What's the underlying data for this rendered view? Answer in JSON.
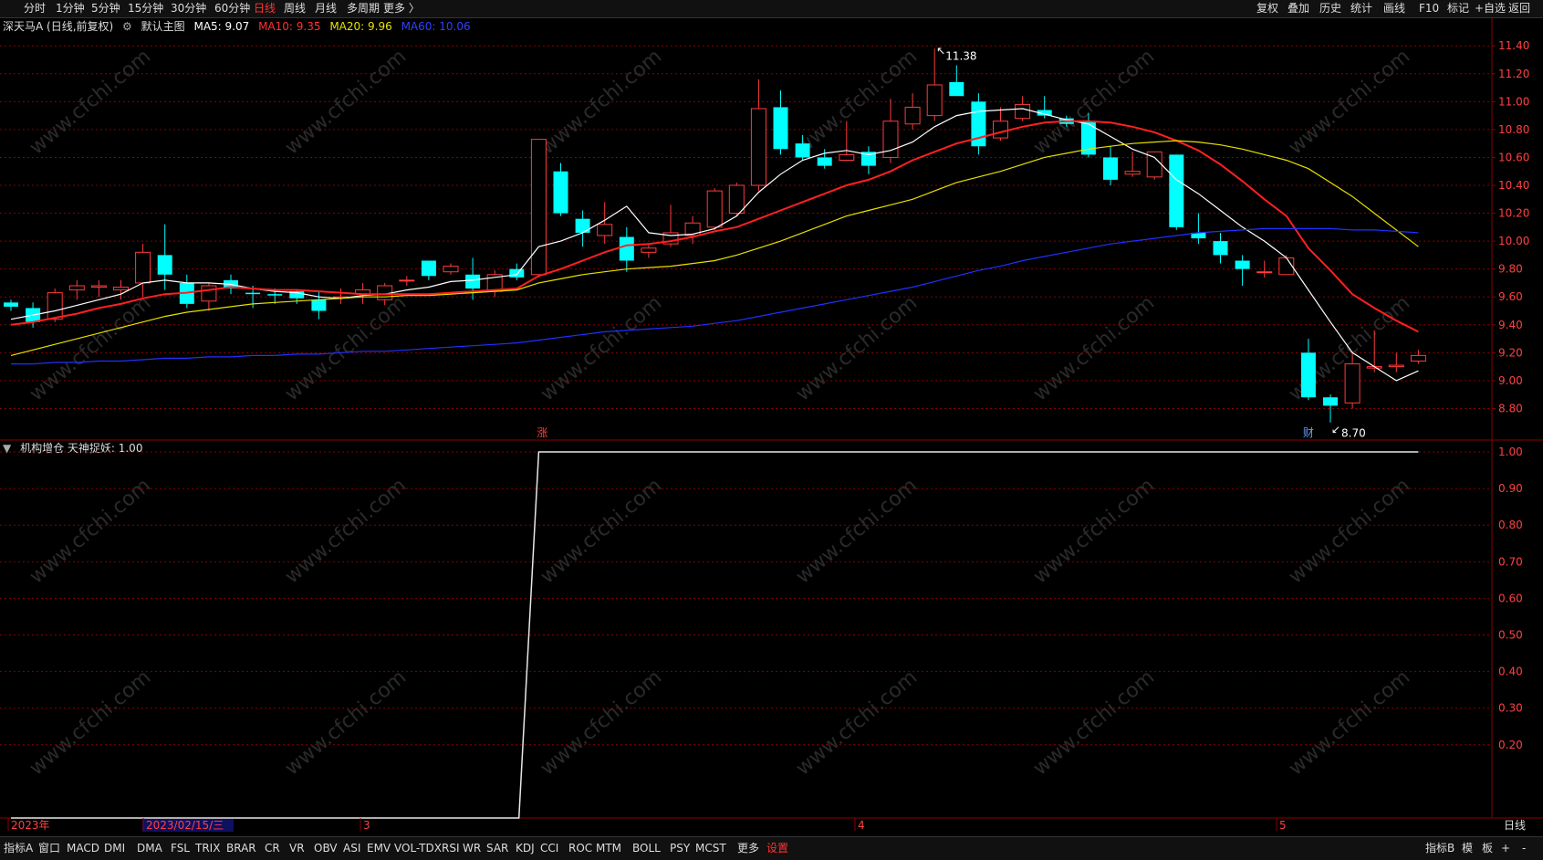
{
  "toolbar": {
    "periods": [
      "分时",
      "1分钟",
      "5分钟",
      "15分钟",
      "30分钟",
      "60分钟",
      "日线",
      "周线",
      "月线",
      "多周期",
      "更多 〉"
    ],
    "active_period": "日线",
    "right": [
      "复权",
      "叠加",
      "历史",
      "统计",
      "画线",
      "F10",
      "标记",
      "+自选",
      "返回"
    ]
  },
  "main_legend": {
    "stock": "深天马A (日线,前复权)",
    "template": "默认主图",
    "ma5": "MA5: 9.07",
    "ma10": "MA10: 9.35",
    "ma20": "MA20: 9.96",
    "ma60": "MA60: 10.06"
  },
  "sub_legend": {
    "text": "机构增仓 天神捉妖: 1.00"
  },
  "colors": {
    "up": "#ff3b3b",
    "down": "#00ffff",
    "ma5": "#ffffff",
    "ma10": "#ff2020",
    "ma20": "#e8e000",
    "ma60": "#2030ff",
    "grid": "#8b0000"
  },
  "watermark": "www.cfchi.com",
  "bottom_tabs": {
    "items": [
      "指标A",
      "窗口",
      "MACD",
      "DMI",
      "DMA",
      "FSL",
      "TRIX",
      "BRAR",
      "CR",
      "VR",
      "OBV",
      "ASI",
      "EMV",
      "VOL-TDX",
      "RSI",
      "WR",
      "SAR",
      "KDJ",
      "CCI",
      "ROC",
      "MTM",
      "BOLL",
      "PSY",
      "MCST",
      "更多",
      "设置"
    ],
    "active": "设置",
    "right": [
      "指标B",
      "模",
      "板",
      "+",
      "-"
    ]
  },
  "chart_data": [
    {
      "type": "candlestick",
      "y_axis_ticks": [
        "8.80",
        "9.00",
        "9.20",
        "9.40",
        "9.60",
        "9.80",
        "10.00",
        "10.20",
        "10.40",
        "10.60",
        "10.80",
        "11.00",
        "11.20",
        "11.40"
      ],
      "ylim": [
        8.6,
        11.48
      ],
      "annotations": {
        "high_label": "11.38",
        "low_label": "8.70",
        "marker_zhang": "涨",
        "marker_cai": "财"
      },
      "x_labels": [
        "2023年",
        "2023/02/15/三",
        "3",
        "4",
        "5"
      ],
      "right_axis_tag": "日线",
      "candles": [
        [
          9.56,
          9.58,
          9.5,
          9.53
        ],
        [
          9.52,
          9.56,
          9.38,
          9.42
        ],
        [
          9.44,
          9.66,
          9.42,
          9.63
        ],
        [
          9.65,
          9.72,
          9.58,
          9.68
        ],
        [
          9.67,
          9.72,
          9.6,
          9.68
        ],
        [
          9.65,
          9.72,
          9.58,
          9.67
        ],
        [
          9.7,
          9.98,
          9.6,
          9.92
        ],
        [
          9.9,
          10.12,
          9.65,
          9.76
        ],
        [
          9.7,
          9.76,
          9.52,
          9.55
        ],
        [
          9.57,
          9.7,
          9.5,
          9.68
        ],
        [
          9.72,
          9.76,
          9.62,
          9.66
        ],
        [
          9.63,
          9.68,
          9.52,
          9.62
        ],
        [
          9.62,
          9.66,
          9.55,
          9.61
        ],
        [
          9.64,
          9.65,
          9.55,
          9.59
        ],
        [
          9.58,
          9.64,
          9.44,
          9.5
        ],
        [
          9.6,
          9.66,
          9.55,
          9.6
        ],
        [
          9.62,
          9.7,
          9.55,
          9.65
        ],
        [
          9.58,
          9.7,
          9.54,
          9.68
        ],
        [
          9.72,
          9.75,
          9.68,
          9.72
        ],
        [
          9.86,
          9.86,
          9.72,
          9.75
        ],
        [
          9.78,
          9.84,
          9.76,
          9.82
        ],
        [
          9.76,
          9.88,
          9.58,
          9.66
        ],
        [
          9.64,
          9.79,
          9.6,
          9.76
        ],
        [
          9.8,
          9.84,
          9.72,
          9.74
        ],
        [
          9.76,
          10.73,
          9.74,
          10.73
        ],
        [
          10.5,
          10.56,
          10.18,
          10.2
        ],
        [
          10.16,
          10.22,
          9.96,
          10.06
        ],
        [
          10.04,
          10.28,
          9.98,
          10.12
        ],
        [
          10.03,
          10.1,
          9.78,
          9.86
        ],
        [
          9.92,
          9.98,
          9.88,
          9.95
        ],
        [
          9.98,
          10.26,
          9.96,
          10.06
        ],
        [
          10.04,
          10.18,
          9.98,
          10.13
        ],
        [
          10.1,
          10.38,
          10.08,
          10.36
        ],
        [
          10.2,
          10.42,
          10.18,
          10.4
        ],
        [
          10.4,
          11.16,
          10.36,
          10.95
        ],
        [
          10.96,
          11.08,
          10.62,
          10.66
        ],
        [
          10.7,
          10.76,
          10.58,
          10.6
        ],
        [
          10.6,
          10.66,
          10.52,
          10.54
        ],
        [
          10.58,
          10.86,
          10.58,
          10.62
        ],
        [
          10.64,
          10.68,
          10.48,
          10.54
        ],
        [
          10.6,
          11.02,
          10.56,
          10.86
        ],
        [
          10.84,
          11.06,
          10.8,
          10.96
        ],
        [
          10.9,
          11.38,
          10.86,
          11.12
        ],
        [
          11.14,
          11.26,
          11.06,
          11.04
        ],
        [
          11.0,
          11.06,
          10.62,
          10.68
        ],
        [
          10.74,
          10.96,
          10.72,
          10.86
        ],
        [
          10.88,
          11.04,
          10.86,
          10.98
        ],
        [
          10.94,
          11.04,
          10.88,
          10.9
        ],
        [
          10.88,
          10.9,
          10.82,
          10.84
        ],
        [
          10.86,
          10.92,
          10.6,
          10.62
        ],
        [
          10.6,
          10.68,
          10.4,
          10.44
        ],
        [
          10.48,
          10.64,
          10.46,
          10.5
        ],
        [
          10.46,
          10.64,
          10.44,
          10.64
        ],
        [
          10.62,
          10.62,
          10.08,
          10.1
        ],
        [
          10.06,
          10.2,
          9.98,
          10.02
        ],
        [
          10.0,
          10.06,
          9.84,
          9.9
        ],
        [
          9.86,
          9.9,
          9.68,
          9.8
        ],
        [
          9.78,
          9.86,
          9.74,
          9.78
        ],
        [
          9.76,
          9.9,
          9.76,
          9.88
        ],
        [
          9.2,
          9.3,
          8.86,
          8.88
        ],
        [
          8.88,
          8.9,
          8.7,
          8.82
        ],
        [
          8.84,
          9.2,
          8.8,
          9.12
        ],
        [
          9.09,
          9.36,
          9.06,
          9.1
        ],
        [
          9.1,
          9.2,
          9.06,
          9.11
        ],
        [
          9.14,
          9.22,
          9.12,
          9.18
        ]
      ],
      "series": [
        {
          "name": "MA5",
          "values": [
            9.44,
            9.47,
            9.5,
            9.54,
            9.58,
            9.62,
            9.7,
            9.72,
            9.7,
            9.7,
            9.69,
            9.66,
            9.64,
            9.63,
            9.6,
            9.59,
            9.61,
            9.62,
            9.65,
            9.67,
            9.71,
            9.72,
            9.74,
            9.76,
            9.96,
            10.0,
            10.06,
            10.15,
            10.25,
            10.06,
            10.04,
            10.05,
            10.09,
            10.18,
            10.35,
            10.48,
            10.58,
            10.63,
            10.65,
            10.62,
            10.65,
            10.71,
            10.82,
            10.9,
            10.93,
            10.94,
            10.95,
            10.91,
            10.87,
            10.84,
            10.75,
            10.66,
            10.6,
            10.44,
            10.34,
            10.22,
            10.1,
            10.0,
            9.88,
            9.65,
            9.42,
            9.2,
            9.1,
            9.0,
            9.07
          ]
        },
        {
          "name": "MA10",
          "values": [
            9.4,
            9.42,
            9.45,
            9.48,
            9.52,
            9.55,
            9.59,
            9.62,
            9.63,
            9.65,
            9.67,
            9.66,
            9.65,
            9.65,
            9.64,
            9.63,
            9.62,
            9.62,
            9.62,
            9.62,
            9.63,
            9.64,
            9.65,
            9.66,
            9.75,
            9.8,
            9.86,
            9.92,
            9.97,
            9.98,
            10.0,
            10.03,
            10.07,
            10.1,
            10.16,
            10.22,
            10.28,
            10.34,
            10.4,
            10.44,
            10.5,
            10.58,
            10.64,
            10.7,
            10.74,
            10.78,
            10.82,
            10.85,
            10.86,
            10.86,
            10.85,
            10.82,
            10.78,
            10.72,
            10.65,
            10.55,
            10.43,
            10.3,
            10.18,
            9.95,
            9.79,
            9.62,
            9.52,
            9.43,
            9.35
          ]
        },
        {
          "name": "MA20",
          "values": [
            9.18,
            9.22,
            9.26,
            9.3,
            9.34,
            9.38,
            9.42,
            9.46,
            9.49,
            9.51,
            9.53,
            9.55,
            9.56,
            9.57,
            9.58,
            9.59,
            9.6,
            9.6,
            9.61,
            9.61,
            9.62,
            9.63,
            9.64,
            9.65,
            9.7,
            9.73,
            9.76,
            9.78,
            9.8,
            9.81,
            9.82,
            9.84,
            9.86,
            9.9,
            9.95,
            10.0,
            10.06,
            10.12,
            10.18,
            10.22,
            10.26,
            10.3,
            10.36,
            10.42,
            10.46,
            10.5,
            10.55,
            10.6,
            10.63,
            10.66,
            10.68,
            10.7,
            10.71,
            10.72,
            10.71,
            10.69,
            10.66,
            10.62,
            10.58,
            10.52,
            10.42,
            10.32,
            10.2,
            10.08,
            9.96
          ]
        },
        {
          "name": "MA60",
          "values": [
            9.12,
            9.12,
            9.13,
            9.13,
            9.14,
            9.14,
            9.15,
            9.16,
            9.16,
            9.17,
            9.17,
            9.18,
            9.18,
            9.19,
            9.19,
            9.2,
            9.21,
            9.21,
            9.22,
            9.23,
            9.24,
            9.25,
            9.26,
            9.27,
            9.29,
            9.31,
            9.33,
            9.35,
            9.36,
            9.37,
            9.38,
            9.39,
            9.41,
            9.43,
            9.46,
            9.49,
            9.52,
            9.55,
            9.58,
            9.61,
            9.64,
            9.67,
            9.71,
            9.75,
            9.79,
            9.82,
            9.86,
            9.89,
            9.92,
            9.95,
            9.98,
            10.0,
            10.02,
            10.04,
            10.06,
            10.07,
            10.08,
            10.09,
            10.09,
            10.09,
            10.09,
            10.08,
            10.08,
            10.07,
            10.06
          ]
        }
      ]
    },
    {
      "type": "line",
      "y_axis_ticks": [
        "0.20",
        "0.30",
        "0.40",
        "0.50",
        "0.60",
        "0.70",
        "0.80",
        "0.90",
        "1.00"
      ],
      "ylim": [
        0,
        1.03
      ],
      "series": [
        {
          "name": "天神捉妖",
          "values": [
            0,
            0,
            0,
            0,
            0,
            0,
            0,
            0,
            0,
            0,
            0,
            0,
            0,
            0,
            0,
            0,
            0,
            0,
            0,
            0,
            0,
            0,
            0,
            0,
            1,
            1,
            1,
            1,
            1,
            1,
            1,
            1,
            1,
            1,
            1,
            1,
            1,
            1,
            1,
            1,
            1,
            1,
            1,
            1,
            1,
            1,
            1,
            1,
            1,
            1,
            1,
            1,
            1,
            1,
            1,
            1,
            1,
            1,
            1,
            1,
            1,
            1,
            1,
            1,
            1
          ]
        }
      ]
    }
  ]
}
